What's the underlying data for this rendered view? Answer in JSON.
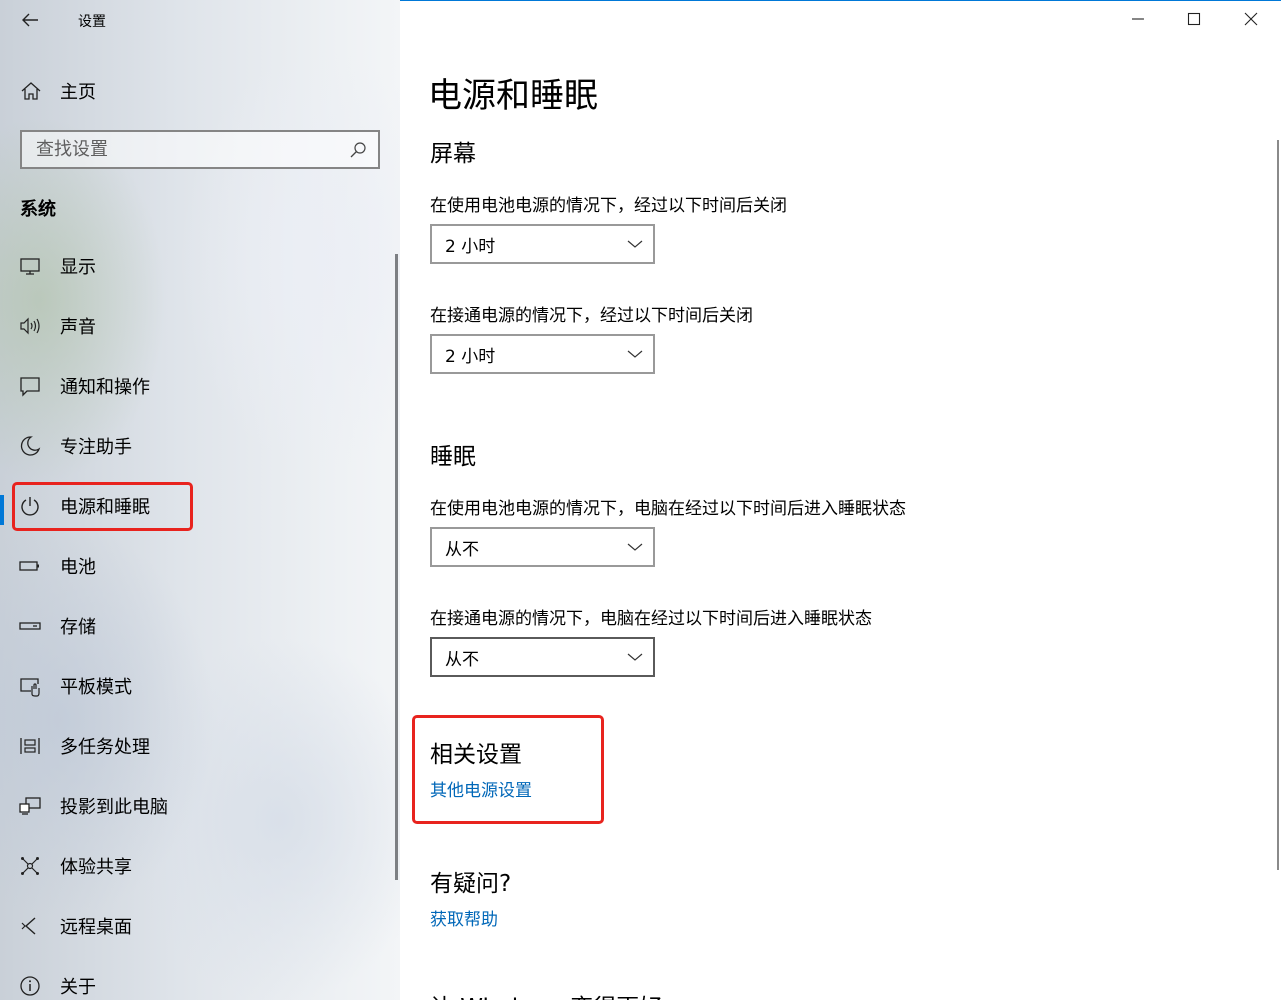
{
  "window": {
    "title": "设置"
  },
  "sidebar": {
    "home_label": "主页",
    "search_placeholder": "查找设置",
    "section_title": "系统",
    "items": [
      {
        "label": "显示",
        "icon": "monitor-icon"
      },
      {
        "label": "声音",
        "icon": "speaker-icon"
      },
      {
        "label": "通知和操作",
        "icon": "notification-icon"
      },
      {
        "label": "专注助手",
        "icon": "moon-icon"
      },
      {
        "label": "电源和睡眠",
        "icon": "power-icon",
        "active": true
      },
      {
        "label": "电池",
        "icon": "battery-icon"
      },
      {
        "label": "存储",
        "icon": "storage-icon"
      },
      {
        "label": "平板模式",
        "icon": "tablet-mode-icon"
      },
      {
        "label": "多任务处理",
        "icon": "multitasking-icon"
      },
      {
        "label": "投影到此电脑",
        "icon": "project-icon"
      },
      {
        "label": "体验共享",
        "icon": "shared-experiences-icon"
      },
      {
        "label": "远程桌面",
        "icon": "remote-desktop-icon"
      },
      {
        "label": "关于",
        "icon": "info-icon"
      }
    ]
  },
  "main": {
    "page_title": "电源和睡眠",
    "screen": {
      "heading": "屏幕",
      "battery_label": "在使用电池电源的情况下，经过以下时间后关闭",
      "battery_value": "2 小时",
      "plugged_label": "在接通电源的情况下，经过以下时间后关闭",
      "plugged_value": "2 小时"
    },
    "sleep": {
      "heading": "睡眠",
      "battery_label": "在使用电池电源的情况下，电脑在经过以下时间后进入睡眠状态",
      "battery_value": "从不",
      "plugged_label": "在接通电源的情况下，电脑在经过以下时间后进入睡眠状态",
      "plugged_value": "从不"
    },
    "related": {
      "heading": "相关设置",
      "link": "其他电源设置"
    },
    "help": {
      "heading": "有疑问?",
      "link": "获取帮助"
    },
    "cutoff_heading": "让 Windows 变得更好"
  },
  "colors": {
    "accent": "#0078d7",
    "link": "#0067b8",
    "highlight": "#e8231e"
  }
}
